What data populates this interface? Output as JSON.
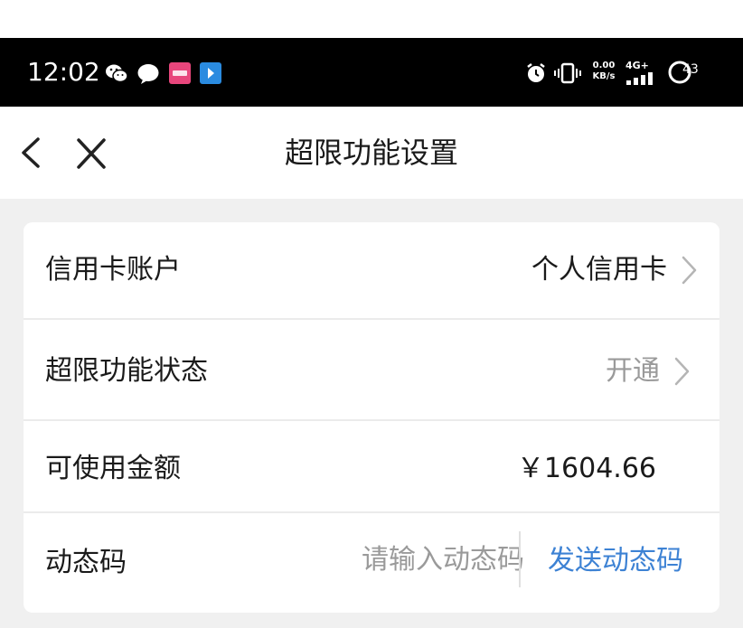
{
  "status_bar": {
    "time": "12:02",
    "net_speed_value": "0.00",
    "net_speed_unit": "KB/s",
    "network_type": "4G+",
    "battery": "43",
    "icons": [
      "wechat-icon",
      "chat-bubble-icon",
      "pink-app-icon",
      "blue-app-icon",
      "alarm-icon",
      "vibrate-icon",
      "signal-icon",
      "battery-icon"
    ]
  },
  "nav": {
    "title": "超限功能设置",
    "back_icon": "chevron-left-icon",
    "close_icon": "close-icon"
  },
  "form": {
    "rows": [
      {
        "label": "信用卡账户",
        "value": "个人信用卡"
      },
      {
        "label": "超限功能状态",
        "value": "开通"
      },
      {
        "label": "可使用金额",
        "value": "￥1604.66"
      },
      {
        "label": "动态码",
        "placeholder": "请输入动态码",
        "action": "发送动态码"
      }
    ]
  },
  "colors": {
    "status_bar_bg": "#000000",
    "page_bg": "#f0f0f0",
    "link": "#3d82d4",
    "muted_text": "#9a9a9a"
  }
}
